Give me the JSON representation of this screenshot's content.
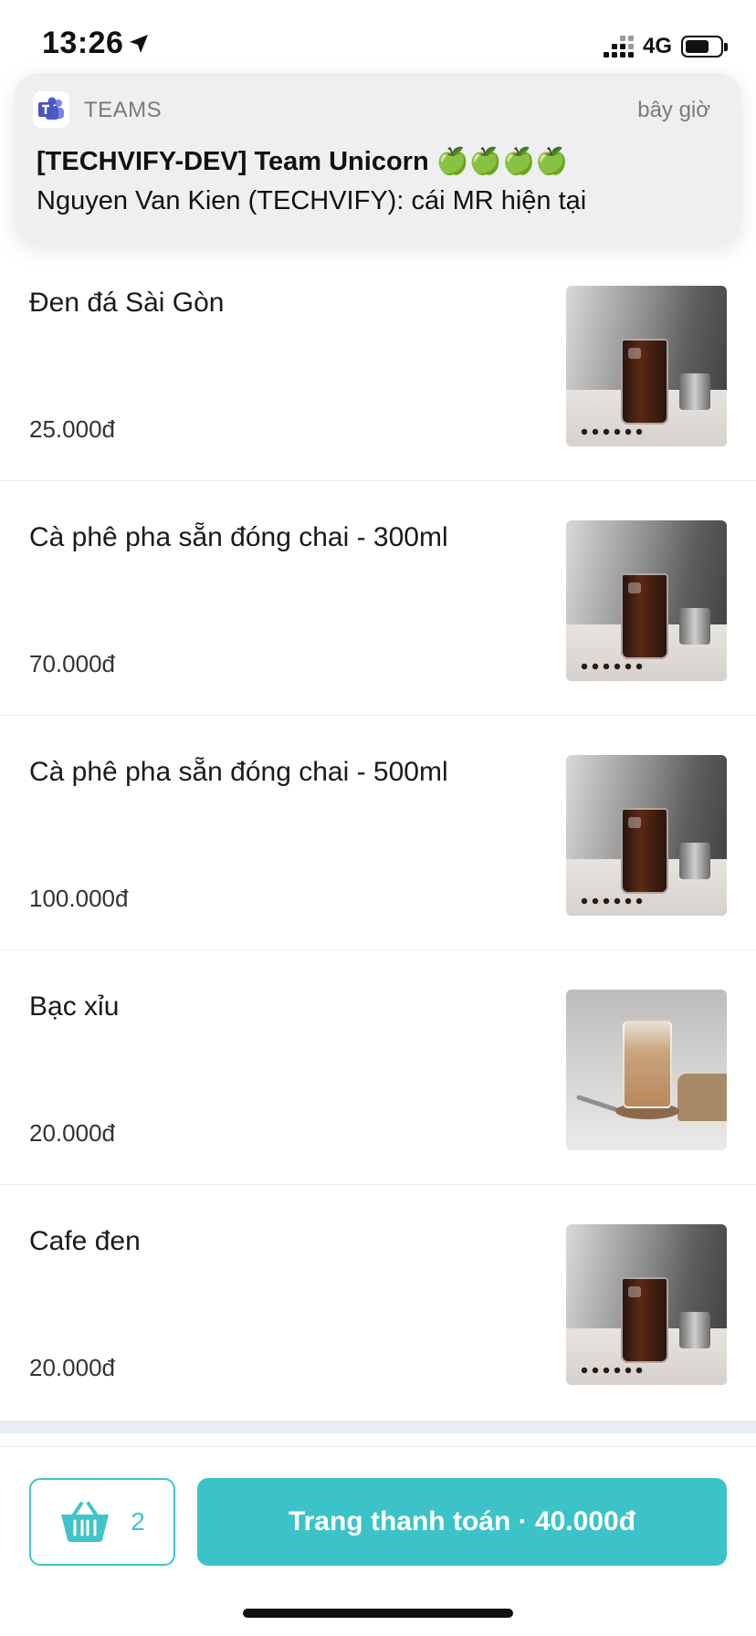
{
  "status_bar": {
    "time": "13:26",
    "network": "4G"
  },
  "notification": {
    "app_name": "TEAMS",
    "time": "bây giờ",
    "title": "[TECHVIFY-DEV] Team Unicorn 🍏🍏🍏🍏",
    "body": "Nguyen Van Kien (TECHVIFY): cái MR hiện tại"
  },
  "products": [
    {
      "name": "Đen đá Sài Gòn",
      "price": "25.000đ",
      "image": "iced-black-coffee"
    },
    {
      "name": "Cà phê pha sẵn đóng chai - 300ml",
      "price": "70.000đ",
      "image": "iced-black-coffee"
    },
    {
      "name": "Cà phê pha sẵn đóng chai - 500ml",
      "price": "100.000đ",
      "image": "iced-black-coffee"
    },
    {
      "name": "Bạc xỉu",
      "price": "20.000đ",
      "image": "bac-xiu"
    },
    {
      "name": "Cafe đen",
      "price": "20.000đ",
      "image": "iced-black-coffee"
    }
  ],
  "cart": {
    "count": "2",
    "icon": "basket-icon"
  },
  "checkout": {
    "label": "Trang thanh toán · 40.000đ"
  },
  "colors": {
    "accent": "#3cc3c8",
    "teams": "#5059c9"
  }
}
